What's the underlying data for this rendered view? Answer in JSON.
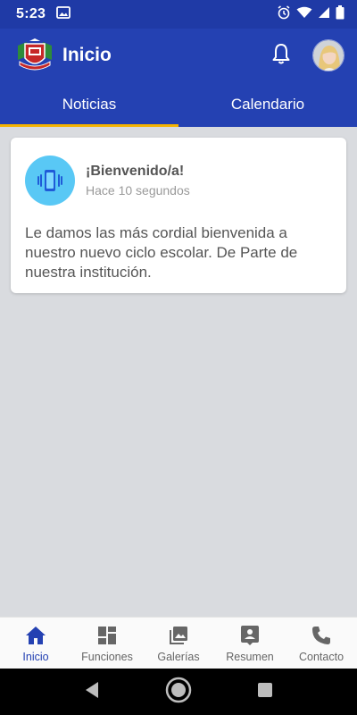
{
  "status_bar": {
    "time": "5:23",
    "icons": [
      "image-notification-icon",
      "alarm-icon",
      "wifi-icon",
      "signal-icon",
      "battery-icon"
    ]
  },
  "app_bar": {
    "title": "Inicio",
    "logo_icon": "school-crest-logo",
    "notification_icon": "bell-icon",
    "avatar": "user-avatar"
  },
  "tabs": [
    {
      "label": "Noticias",
      "active": true
    },
    {
      "label": "Calendario",
      "active": false
    }
  ],
  "news": [
    {
      "icon": "phone-vibrate-icon",
      "title": "¡Bienvenido/a!",
      "time": "Hace 10 segundos",
      "body": "Le damos las más cordial bienvenida a nuestro nuevo ciclo escolar. De Parte de nuestra institución."
    }
  ],
  "bottom_nav": [
    {
      "label": "Inicio",
      "icon": "home-icon",
      "active": true
    },
    {
      "label": "Funciones",
      "icon": "dashboard-icon",
      "active": false
    },
    {
      "label": "Galerías",
      "icon": "photo-library-icon",
      "active": false
    },
    {
      "label": "Resumen",
      "icon": "person-summary-icon",
      "active": false
    },
    {
      "label": "Contacto",
      "icon": "phone-icon",
      "active": false
    }
  ],
  "colors": {
    "primary": "#2441b2",
    "status_bar": "#1f3aa6",
    "tab_indicator": "#f5b301",
    "background": "#d9dbdf",
    "card_icon_bg": "#59c8f5"
  }
}
